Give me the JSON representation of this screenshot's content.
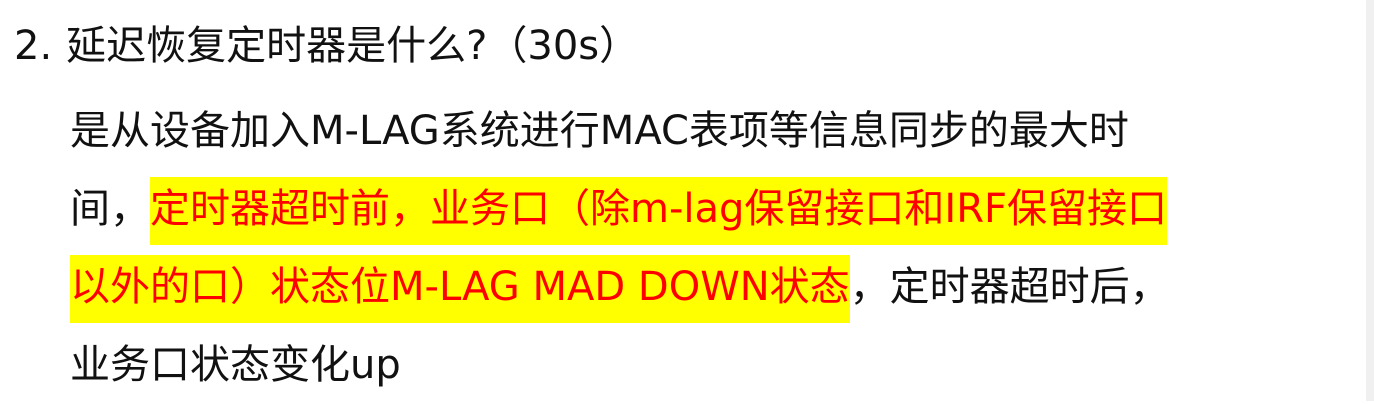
{
  "question": {
    "number": "2.",
    "text": "延迟恢复定时器是什么?（30s）"
  },
  "answer": {
    "line1": "是从设备加入M-LAG系统进行MAC表项等信息同步的最大时",
    "line2_plain": "间，",
    "line2_highlight": "定时器超时前，业务口（除m-lag保留接口和IRF保留接口",
    "line3_highlight": "以外的口）状态位M-LAG MAD DOWN状态",
    "line3_plain": "，定时器超时后，",
    "line4": "业务口状态变化up"
  },
  "colors": {
    "highlight_bg": "#ffff00",
    "highlight_text": "#ff0000",
    "body_text": "#111111"
  }
}
